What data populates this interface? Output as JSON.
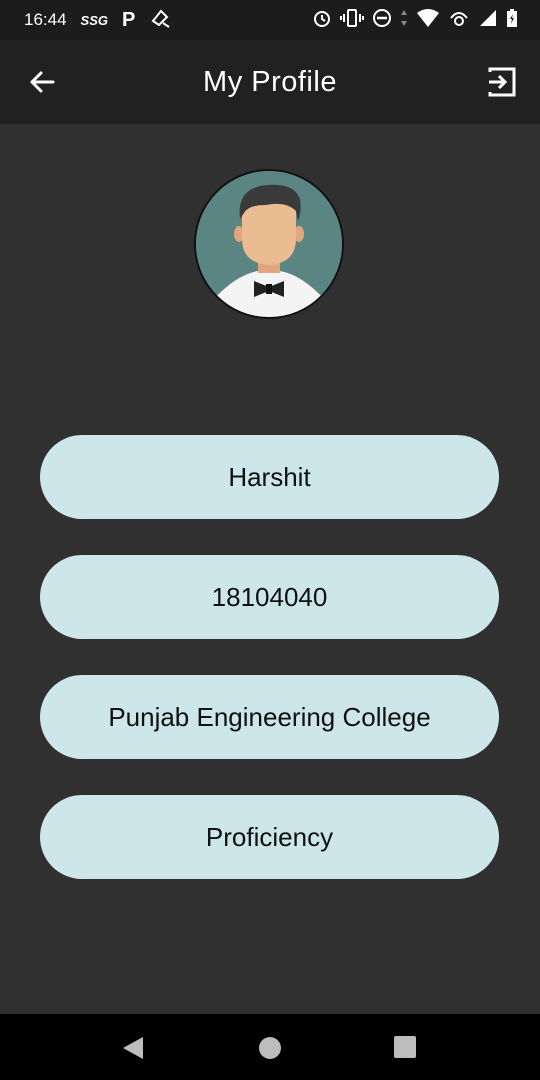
{
  "status_bar": {
    "time": "16:44",
    "carrier_badge": "SSG",
    "app_badge": "P",
    "icons": [
      "clean-icon",
      "alarm-icon",
      "vibrate-icon",
      "dnd-icon",
      "data-arrows-icon",
      "wifi-icon",
      "hotspot-icon",
      "signal-icon",
      "battery-icon"
    ]
  },
  "app_bar": {
    "title": "My Profile",
    "back_icon": "arrow-left-icon",
    "logout_icon": "logout-icon"
  },
  "profile": {
    "avatar_icon": "man-avatar-icon",
    "name": "Harshit",
    "roll_number": "18104040",
    "college": "Punjab Engineering College",
    "proficiency": "Proficiency"
  },
  "colors": {
    "background": "#303030",
    "app_bar": "#212121",
    "status_bar": "#1c1c1c",
    "pill": "#cde6ea",
    "avatar_bg": "#5a8583"
  },
  "nav_bar": {
    "icons": [
      "back-triangle-icon",
      "home-circle-icon",
      "recents-square-icon"
    ]
  }
}
